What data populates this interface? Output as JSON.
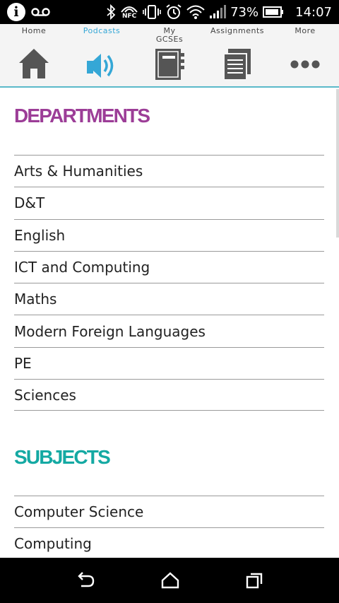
{
  "status_bar": {
    "battery": "73%",
    "time": "14:07",
    "nfc": "NFC"
  },
  "tabs": [
    {
      "label": "Home",
      "icon": "home-icon",
      "active": false
    },
    {
      "label": "Podcasts",
      "icon": "speaker-icon",
      "active": true
    },
    {
      "label": "My GCSEs",
      "icon": "notebook-icon",
      "active": false
    },
    {
      "label": "Assignments",
      "icon": "documents-icon",
      "active": false
    },
    {
      "label": "More",
      "icon": "more-dots-icon",
      "active": false
    }
  ],
  "departments": {
    "heading": "DEPARTMENTS",
    "items": [
      "Arts & Humanities",
      "D&T",
      "English",
      "ICT and Computing",
      "Maths",
      "Modern Foreign Languages",
      "PE",
      "Sciences"
    ]
  },
  "subjects": {
    "heading": "SUBJECTS",
    "items": [
      "Computer Science",
      "Computing"
    ]
  },
  "colors": {
    "departments_heading": "#9c3d97",
    "subjects_heading": "#14a9a3",
    "active_tab": "#35a7d6",
    "nav_underline": "#5bb9c9"
  }
}
